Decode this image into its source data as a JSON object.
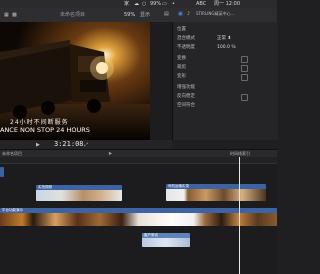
{
  "menubar": {
    "items": [
      {
        "label": "家"
      },
      {
        "label": "☁"
      },
      {
        "label": "○"
      },
      {
        "label": "99%"
      },
      {
        "label": "▭"
      },
      {
        "label": "•"
      },
      {
        "label": "ABC"
      },
      {
        "label": "周一 12:00"
      }
    ]
  },
  "toolbar": {
    "viewer_title": "未命名项目",
    "zoom": "59%",
    "view_label": "显示",
    "inspector_clip_name": "STIRLING精英中心..."
  },
  "viewer": {
    "caption_line1": "24小时不间断服务",
    "caption_line2": "ANCE NON STOP 24 HOURS"
  },
  "inspector": {
    "rows": [
      {
        "label": "位置",
        "value": ""
      },
      {
        "label": "混合模式",
        "value": "正常 ⬍"
      },
      {
        "label": "不透明度",
        "value": "100.0 %"
      },
      {
        "label": "变换",
        "value": ""
      },
      {
        "label": "裁剪",
        "value": ""
      },
      {
        "label": "变形",
        "value": ""
      },
      {
        "label": "增强功能",
        "value": ""
      },
      {
        "label": "反向稳定",
        "value": ""
      },
      {
        "label": "空间符合",
        "value": ""
      }
    ]
  },
  "transport": {
    "timecode": "3:21:08"
  },
  "timeline": {
    "project_label": "未命名项目",
    "index_label": "时间线索引",
    "clips": [
      {
        "label": "实拍视频"
      },
      {
        "label": "司机运输实录"
      },
      {
        "label": "平台功能演示"
      },
      {
        "label": "客户采访"
      }
    ]
  },
  "colors": {
    "accent": "#4a8fe0",
    "clip_blue": "#3e63a3",
    "clip_light": "#6f8fc4",
    "playhead": "#e8e8e8"
  }
}
